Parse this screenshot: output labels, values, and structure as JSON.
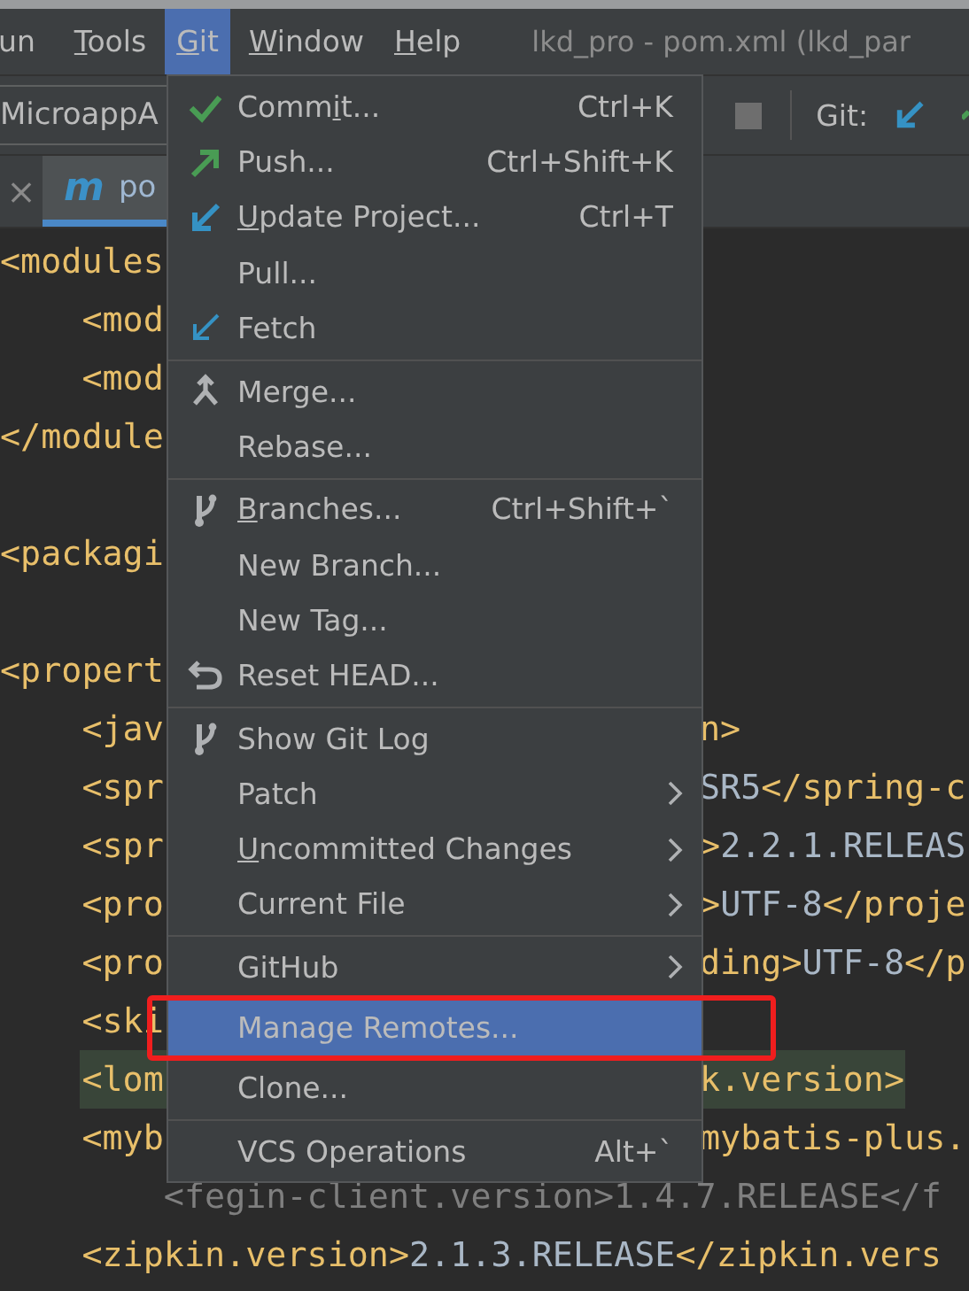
{
  "menubar": {
    "items": [
      {
        "label": {
          "before": "un"
        },
        "selected": false
      },
      {
        "label": {
          "mnemonic": "T",
          "after": "ools"
        },
        "selected": false
      },
      {
        "label": {
          "mnemonic": "G",
          "after": "it"
        },
        "selected": true
      },
      {
        "label": {
          "mnemonic": "W",
          "after": "indow"
        },
        "selected": false
      },
      {
        "label": {
          "mnemonic": "H",
          "after": "elp"
        },
        "selected": false
      }
    ],
    "title": "lkd_pro - pom.xml (lkd_par"
  },
  "toolbar": {
    "run_config": "MicroappA",
    "git_label": "Git:"
  },
  "tabs": [
    {
      "label": "po",
      "selected": true
    }
  ],
  "tab_close": "×",
  "tab_icon_letter": "m",
  "editor": {
    "lines": [
      {
        "kind": "code",
        "left": [
          {
            "text": "<modules",
            "kind": "tag"
          }
        ]
      },
      {
        "kind": "code",
        "left": [
          {
            "text": "    <mod",
            "kind": "tag"
          }
        ]
      },
      {
        "kind": "code",
        "left": [
          {
            "text": "    <mod",
            "kind": "tag"
          }
        ]
      },
      {
        "kind": "code",
        "left": [
          {
            "text": "</module",
            "kind": "tag"
          }
        ]
      },
      {
        "kind": "blank"
      },
      {
        "kind": "code",
        "left": [
          {
            "text": "<packagi",
            "kind": "tag"
          }
        ]
      },
      {
        "kind": "blank"
      },
      {
        "kind": "code",
        "left": [
          {
            "text": "<propert",
            "kind": "tag"
          }
        ]
      },
      {
        "kind": "code",
        "left": [
          {
            "text": "    <jav",
            "kind": "tag"
          }
        ],
        "right": [
          {
            "text": "n>",
            "kind": "tag"
          }
        ]
      },
      {
        "kind": "code",
        "left": [
          {
            "text": "    <spr",
            "kind": "tag"
          }
        ],
        "right": [
          {
            "text": "SR5",
            "kind": "value"
          },
          {
            "text": "</spring-c",
            "kind": "tag"
          }
        ]
      },
      {
        "kind": "code",
        "left": [
          {
            "text": "    <spr",
            "kind": "tag"
          }
        ],
        "right": [
          {
            "text": ">",
            "kind": "tag"
          },
          {
            "text": "2.2.1.RELEAS",
            "kind": "value"
          }
        ]
      },
      {
        "kind": "code",
        "left": [
          {
            "text": "    <pro",
            "kind": "tag"
          }
        ],
        "right": [
          {
            "text": ">",
            "kind": "tag"
          },
          {
            "text": "UTF-8",
            "kind": "value"
          },
          {
            "text": "</proje",
            "kind": "tag"
          }
        ]
      },
      {
        "kind": "code",
        "left": [
          {
            "text": "    <pro",
            "kind": "tag"
          }
        ],
        "right": [
          {
            "text": "ding>",
            "kind": "tag"
          },
          {
            "text": "UTF-8",
            "kind": "value"
          },
          {
            "text": "</p",
            "kind": "tag"
          }
        ]
      },
      {
        "kind": "code",
        "left": [
          {
            "text": "    <ski",
            "kind": "tag"
          }
        ]
      },
      {
        "kind": "code",
        "highlighted": true,
        "left": [
          {
            "text": "    <lom",
            "kind": "tag"
          }
        ],
        "right": [
          {
            "text": "k.version>",
            "kind": "tag"
          }
        ]
      },
      {
        "kind": "code",
        "left": [
          {
            "text": "    <myb",
            "kind": "tag"
          }
        ],
        "right": [
          {
            "text": "mybatis-plus.",
            "kind": "tag"
          }
        ]
      },
      {
        "kind": "code",
        "left": [
          {
            "text": "        <fegin-client.version>1.4.7.RELEASE</f",
            "kind": "comment"
          }
        ]
      },
      {
        "kind": "code",
        "left": [
          {
            "text": "    <zipkin.version>",
            "kind": "tag"
          },
          {
            "text": "2.1.3.RELEASE",
            "kind": "value"
          },
          {
            "text": "</zipkin.vers",
            "kind": "tag"
          }
        ]
      }
    ]
  },
  "git_menu": {
    "groups": [
      [
        {
          "label": {
            "before": "Comm",
            "mnemonic": "i",
            "after": "t..."
          },
          "shortcut": "Ctrl+K",
          "selected": false
        },
        {
          "label": {
            "before": "Push..."
          },
          "shortcut": "Ctrl+Shift+K",
          "selected": false
        },
        {
          "label": {
            "mnemonic": "U",
            "after": "pdate Project..."
          },
          "shortcut": "Ctrl+T",
          "selected": false
        },
        {
          "label": {
            "before": "Pull..."
          },
          "selected": false
        },
        {
          "label": {
            "before": "Fetch"
          },
          "selected": false
        }
      ],
      [
        {
          "label": {
            "before": "Merge..."
          },
          "selected": false
        },
        {
          "label": {
            "before": "Rebase..."
          },
          "selected": false
        }
      ],
      [
        {
          "label": {
            "mnemonic": "B",
            "after": "ranches..."
          },
          "shortcut": "Ctrl+Shift+`",
          "selected": false
        },
        {
          "label": {
            "before": "New Branch..."
          },
          "selected": false
        },
        {
          "label": {
            "before": "New Tag..."
          },
          "selected": false
        },
        {
          "label": {
            "before": "Reset HEAD..."
          },
          "selected": false
        }
      ],
      [
        {
          "label": {
            "before": "Show Git Log"
          },
          "selected": false
        },
        {
          "label": {
            "before": "Patch"
          },
          "submenu": true,
          "selected": false
        },
        {
          "label": {
            "mnemonic": "U",
            "after": "ncommitted Changes"
          },
          "submenu": true,
          "selected": false
        },
        {
          "label": {
            "before": "Current File"
          },
          "submenu": true,
          "selected": false
        }
      ],
      [
        {
          "label": {
            "before": "GitHub"
          },
          "submenu": true,
          "selected": false
        },
        {
          "label": {
            "before": "Manage Remotes..."
          },
          "selected": true,
          "highlighted_by_annotation": true
        },
        {
          "label": {
            "before": "Clone..."
          },
          "selected": false
        }
      ],
      [
        {
          "label": {
            "before": "VCS Operations"
          },
          "shortcut": "Alt+`",
          "selected": false
        }
      ]
    ]
  }
}
